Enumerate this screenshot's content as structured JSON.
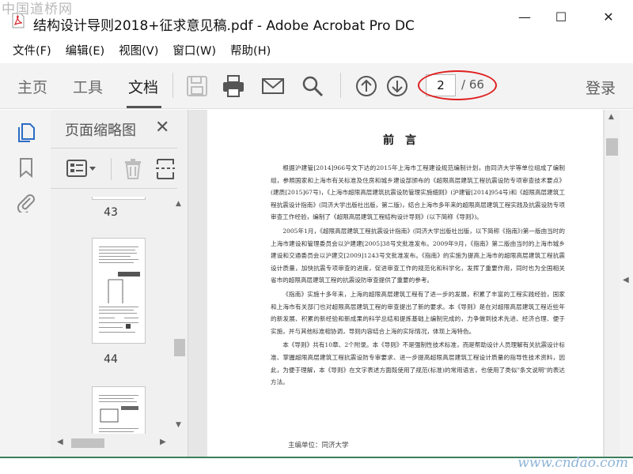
{
  "watermark": {
    "top": "中国道桥网",
    "bottom": "www.cndao.com"
  },
  "window": {
    "title": "结构设计导则2018+征求意见稿.pdf - Adobe Acrobat Pro DC",
    "controls": {
      "minimize": "—",
      "maximize": "☐",
      "close": "✕"
    }
  },
  "menu": {
    "items": [
      "文件(F)",
      "编辑(E)",
      "视图(V)",
      "窗口(W)",
      "帮助(H)"
    ]
  },
  "toolbar": {
    "tabs": {
      "home": "主页",
      "tools": "工具",
      "document": "文档"
    },
    "icons": [
      "save-icon",
      "print-icon",
      "email-icon",
      "search-icon",
      "page-up-icon",
      "page-down-icon"
    ],
    "page_current": "2",
    "page_total": "/ 66",
    "login": "登录"
  },
  "left_rail": {
    "icons": [
      "page-thumbnails-icon",
      "bookmark-icon",
      "attachment-icon"
    ]
  },
  "thumbnails": {
    "title": "页面缩略图",
    "close": "✕",
    "pages": [
      "43",
      "44"
    ]
  },
  "document": {
    "heading": "前言",
    "paragraphs": [
      "根据沪建管[2014]966号文下达的2015年上海市工程建设规范编制计划，由同济大学等单位组成了编制组，参照国家和上海市有关标准及住房和城乡建设部颁布的《超限高层建筑工程抗震设防专项审查技术要点》(建质[2015]67号)，《上海市超限高层建筑抗震设防管理实施细则》(沪建管[2014]954号)和《超限高层建筑工程抗震设计指南》(同济大学出版社出版，第二版)，结合上海市多年来的超限高层建筑工程实践及抗震设防专项审查工作经验，编制了《超限高层建筑工程结构设计导则》(以下简称《导则》)。",
      "2005年1月，《超限高层建筑工程抗震设计指南》(同济大学出版社出版，以下简称《指南》)第一版由当时的上海市建设和管理委员会以沪建建[2005]38号文批准发布。2009年9月，《指南》第二版由当时的上海市城乡建设和交通委员会以沪建交[2009]1243号文批准发布。《指南》的实施为提高上海市的超限高层建筑工程抗震设计质量，加快抗震专项审查的进度，促进审查工作的规范化和科学化，发挥了重要作用，同时也为全国相关省市的超限高层建筑工程的抗震设防审查提供了重要的参考。",
      "《指南》实施十多年来，上海的超限高层建筑工程有了进一步的发展，积累了丰富的工程实践经验，国家和上海市有关部门也对超限高层建筑工程的审查提出了新的要求。本《导则》是在对超限高层建筑工程近些年的新发展、积累的新经验和新成果的科学总结和提炼基础上编制完成的，力争做到技术先进、经济合理、便于实施，并与其他标准相协调，导则内容结合上海的实际情况，体现上海特色。",
      "本《导则》共有10章、2个附录。本《导则》不是强制性技术标准，而是帮助设计人员理解有关抗震设计标准、掌握超限高层建筑工程抗震设防专审要求、进一步提高超限高层建筑工程设计质量的指导性技术资料，因此，为便于理解，本《导则》在文字表述方面既使用了规范(标准)的常用语言，也使用了类似\"条文说明\"的表达方法。"
    ],
    "footer": "主编单位：同济大学"
  },
  "colors": {
    "highlight": "#e01e1e",
    "toolbar_bg": "#f3f3f3",
    "accent_blue": "#2b6cc4"
  }
}
